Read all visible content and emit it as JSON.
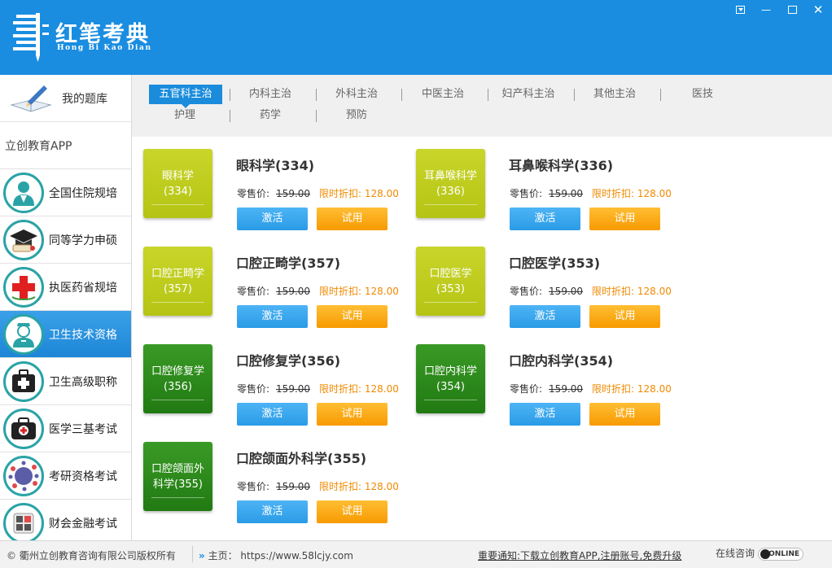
{
  "app": {
    "title": "红笔考典",
    "subtitle": "Hong Bi Kao Dian"
  },
  "sidebar": {
    "my_library": "我的题库",
    "app_label": "立创教育APP",
    "items": [
      {
        "label": "全国住院规培",
        "icon": "doctor-icon"
      },
      {
        "label": "同等学力申硕",
        "icon": "graduation-cap-icon"
      },
      {
        "label": "执医药省规培",
        "icon": "red-cross-icon"
      },
      {
        "label": "卫生技术资格",
        "icon": "nurse-icon",
        "active": true
      },
      {
        "label": "卫生高级职称",
        "icon": "first-aid-kit-icon"
      },
      {
        "label": "医学三基考试",
        "icon": "medical-bag-icon"
      },
      {
        "label": "考研资格考试",
        "icon": "molecule-icon"
      },
      {
        "label": "财会金融考试",
        "icon": "calculator-icon"
      }
    ]
  },
  "tabs": [
    "五官科主治",
    "内科主治",
    "外科主治",
    "中医主治",
    "妇产科主治",
    "其他主治",
    "医技",
    "护理",
    "药学",
    "预防"
  ],
  "active_tab": "五官科主治",
  "products": [
    {
      "thumb": "眼科学\n(334)",
      "title": "眼科学(334)",
      "color": "yellow-green"
    },
    {
      "thumb": "耳鼻喉科学\n(336)",
      "title": "耳鼻喉科学(336)",
      "color": "yellow-green"
    },
    {
      "thumb": "口腔正畸学\n(357)",
      "title": "口腔正畸学(357)",
      "color": "yellow-green"
    },
    {
      "thumb": "口腔医学\n(353)",
      "title": "口腔医学(353)",
      "color": "yellow-green"
    },
    {
      "thumb": "口腔修复学\n(356)",
      "title": "口腔修复学(356)",
      "color": "green"
    },
    {
      "thumb": "口腔内科学\n(354)",
      "title": "口腔内科学(354)",
      "color": "green"
    },
    {
      "thumb": "口腔颌面外\n科学(355)",
      "title": "口腔颌面外科学(355)",
      "color": "green"
    }
  ],
  "labels": {
    "price_label": "零售价:",
    "old_price": "159.00",
    "discount": "限时折扣: 128.00",
    "activate": "激活",
    "trial": "试用"
  },
  "footer": {
    "copyright": "© 衢州立创教育咨询有限公司版权所有",
    "homepage": "主页： https://www.58lcjy.com",
    "notice": "重要通知:下载立创教育APP,注册账号,免费升级",
    "consult": "在线咨询",
    "online_badge": "ONLINE"
  },
  "colors": {
    "header_blue": "#1a8de0",
    "active_tab": "#1b8cdc",
    "thumb_yellow_green": "#c0cd1f",
    "thumb_green": "#2b8a1b",
    "activate_button": "#3aa8ef",
    "trial_button": "#fbab1a",
    "discount_text": "#f08a00"
  }
}
